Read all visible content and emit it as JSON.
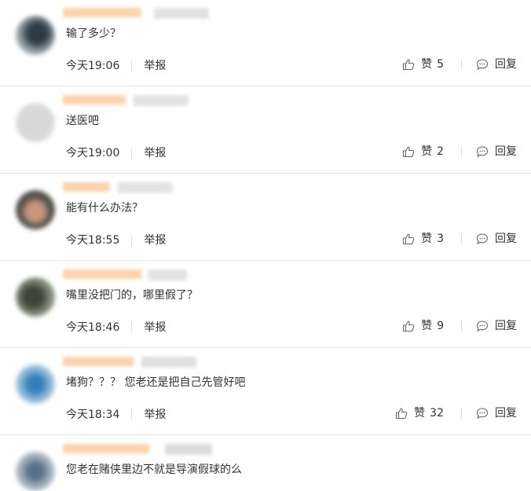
{
  "comments": [
    {
      "text": "输了多少？",
      "time": "今天19:06",
      "report": "举报",
      "like_label": "赞",
      "likes": "5",
      "reply": "回复"
    },
    {
      "text": "送医吧",
      "time": "今天19:00",
      "report": "举报",
      "like_label": "赞",
      "likes": "2",
      "reply": "回复"
    },
    {
      "text": "能有什么办法？",
      "time": "今天18:55",
      "report": "举报",
      "like_label": "赞",
      "likes": "3",
      "reply": "回复"
    },
    {
      "text": "嘴里没把门的，哪里假了？",
      "time": "今天18:46",
      "report": "举报",
      "like_label": "赞",
      "likes": "9",
      "reply": "回复"
    },
    {
      "text": "堵狗？？？ 您老还是把自己先管好吧",
      "time": "今天18:34",
      "report": "举报",
      "like_label": "赞",
      "likes": "32",
      "reply": "回复"
    },
    {
      "text": "您老在赌侠里边不就是导演假球的么"
    }
  ],
  "colors": {
    "name_blur": "#fcd9b8",
    "tag_blur": "#e6e6e6",
    "divider": "#e6e6e6"
  },
  "icons": {
    "like": "thumbs-up-icon",
    "reply": "comment-bubble-icon"
  }
}
